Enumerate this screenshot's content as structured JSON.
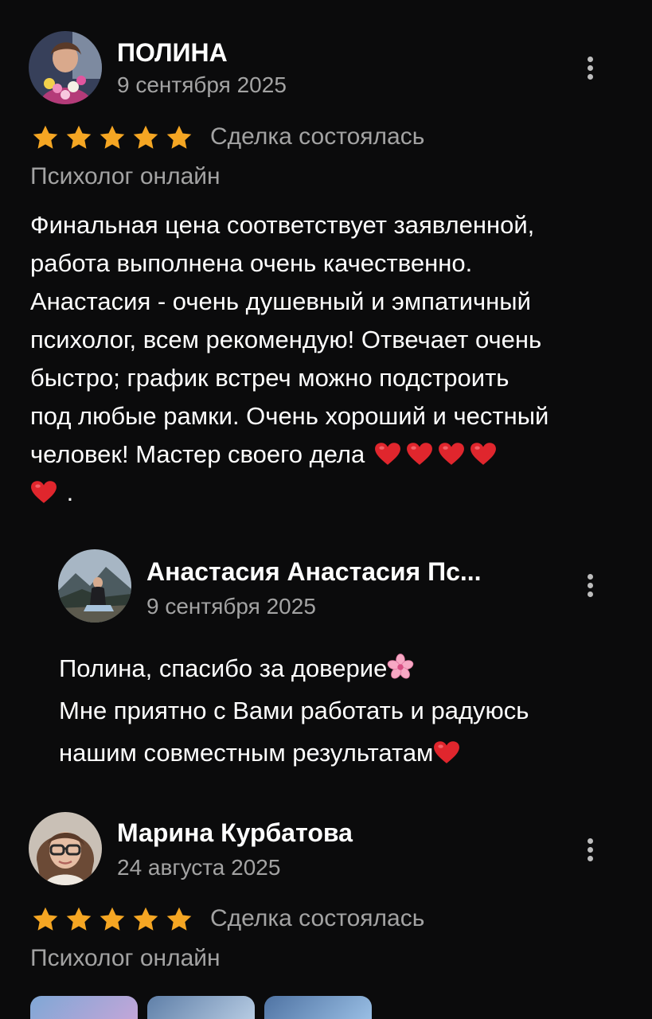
{
  "reviews": [
    {
      "author": "ПОЛИНА",
      "date": "9 сентября 2025",
      "rating": 5,
      "deal_status": "Сделка состоялась",
      "service": "Психолог онлайн",
      "text_lines": [
        "Финальная цена соответствует заявленной,",
        "работа выполнена очень качественно.",
        "Анастасия - очень душевный и эмпатичный",
        "психолог, всем рекомендую! Отвечает очень",
        "быстро; график встреч можно подстроить",
        "под любые рамки. Очень хороший и честный",
        "человек! Мастер своего дела"
      ],
      "text_tail": ".",
      "heart_emoji": "❤️",
      "heart_count_line7": 4,
      "heart_count_line8": 1,
      "reply": {
        "author": "Анастасия Анастасия Пс...",
        "date": "9 сентября 2025",
        "text_lines": [
          "Полина, спасибо за доверие",
          "Мне приятно с Вами работать и радуюсь",
          "нашим совместным результатам"
        ],
        "flower_emoji": "🌸",
        "heart_emoji": "❤️"
      }
    },
    {
      "author": "Марина Курбатова",
      "date": "24 августа 2025",
      "rating": 5,
      "deal_status": "Сделка состоялась",
      "service": "Психолог онлайн",
      "photo_thumbnails": 3
    }
  ],
  "colors": {
    "background": "#0b0b0c",
    "star": "#f5a623",
    "secondary_text": "#a3a3a3",
    "heart": "#e0262d"
  },
  "icons": {
    "menu": "more-vertical-icon",
    "star": "star-icon",
    "heart": "red-heart-emoji",
    "flower": "cherry-blossom-emoji"
  }
}
